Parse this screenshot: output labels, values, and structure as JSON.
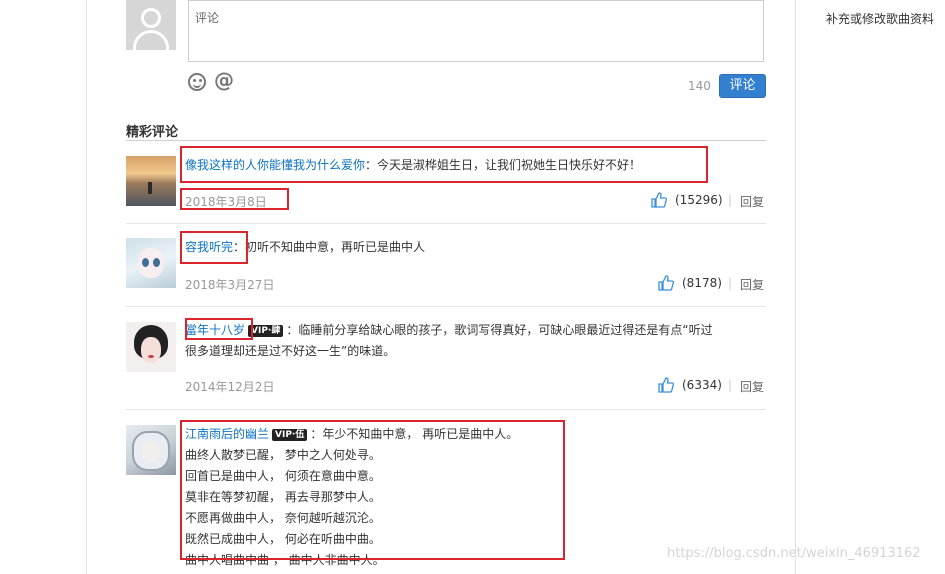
{
  "sidebar": {
    "edit_link": "补充或修改歌曲资料"
  },
  "composer": {
    "placeholder": "评论",
    "char_count": "140",
    "submit_label": "评论"
  },
  "section": {
    "title": "精彩评论"
  },
  "comments": [
    {
      "user": "像我这样的人你能懂我为什么爱你",
      "vip": "",
      "colon": "：",
      "lines": [
        "今天是淑桦姐生日，让我们祝她生日快乐好不好！"
      ],
      "date": "2018年3月8日",
      "likes": "(15296)",
      "reply": "回复"
    },
    {
      "user": "容我听完",
      "vip": "",
      "colon": "：",
      "lines": [
        "初听不知曲中意，再听已是曲中人"
      ],
      "date": "2018年3月27日",
      "likes": "(8178)",
      "reply": "回复"
    },
    {
      "user": "當年十八岁",
      "vip": "VIP·肆",
      "colon": "：",
      "lines": [
        "临睡前分享给缺心眼的孩子，歌词写得真好，可缺心眼最近过得还是有点“听过",
        "很多道理却还是过不好这一生”的味道。"
      ],
      "date": "2014年12月2日",
      "likes": "(6334)",
      "reply": "回复"
    },
    {
      "user": "江南雨后的幽兰",
      "vip": "VIP·伍",
      "colon": "：",
      "lines": [
        "年少不知曲中意， 再听已是曲中人。",
        "曲终人散梦已醒， 梦中之人何处寻。",
        "回首已是曲中人， 何须在意曲中意。",
        "莫非在等梦初醒， 再去寻那梦中人。",
        "不愿再做曲中人， 奈何越听越沉沦。",
        "既然已成曲中人， 何必在听曲中曲。",
        "曲中人唱曲中曲 ， 曲中人非曲中人。"
      ],
      "date": "",
      "likes": "",
      "reply": ""
    }
  ],
  "watermark": "https://blog.csdn.net/weixin_46913162"
}
